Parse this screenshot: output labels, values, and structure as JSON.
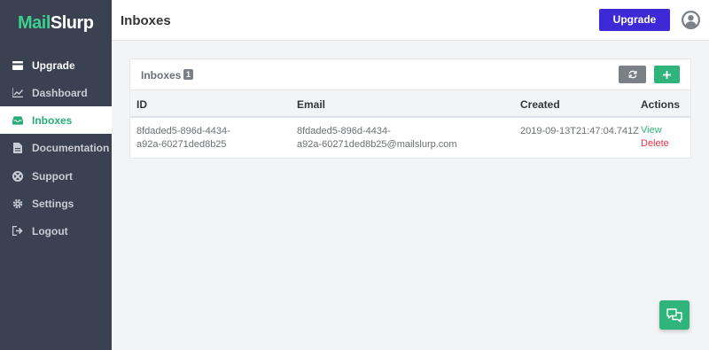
{
  "brand": {
    "part1": "Mail",
    "part2": "Slurp"
  },
  "sidebar": {
    "items": [
      {
        "label": "Upgrade",
        "icon": "card-icon"
      },
      {
        "label": "Dashboard",
        "icon": "chart-icon"
      },
      {
        "label": "Inboxes",
        "icon": "inbox-icon",
        "active": true
      },
      {
        "label": "Documentation",
        "icon": "document-icon"
      },
      {
        "label": "Support",
        "icon": "lifebuoy-icon"
      },
      {
        "label": "Settings",
        "icon": "gear-icon"
      },
      {
        "label": "Logout",
        "icon": "logout-icon"
      }
    ]
  },
  "header": {
    "title": "Inboxes",
    "upgrade_label": "Upgrade",
    "avatar_icon": "user-circle-icon"
  },
  "card": {
    "title": "Inboxes",
    "count": "1",
    "refresh_icon": "refresh-icon",
    "add_icon": "plus-icon"
  },
  "table": {
    "columns": [
      "ID",
      "Email",
      "Created",
      "Actions"
    ],
    "rows": [
      {
        "id_line1": "8fdaded5-896d-4434-",
        "id_line2": "a92a-60271ded8b25",
        "email_line1": "8fdaded5-896d-4434-",
        "email_line2": "a92a-60271ded8b25@mailslurp.com",
        "created": "2019-09-13T21:47:04.741Z",
        "view_label": "View",
        "delete_label": "Delete"
      }
    ]
  },
  "chat": {
    "icon": "chat-icon"
  },
  "colors": {
    "sidebar_bg": "#3a4150",
    "brand_green": "#3ccf8e",
    "accent_green": "#2fb57b",
    "upgrade_purple": "#3e29d6",
    "delete_red": "#e2334b"
  }
}
